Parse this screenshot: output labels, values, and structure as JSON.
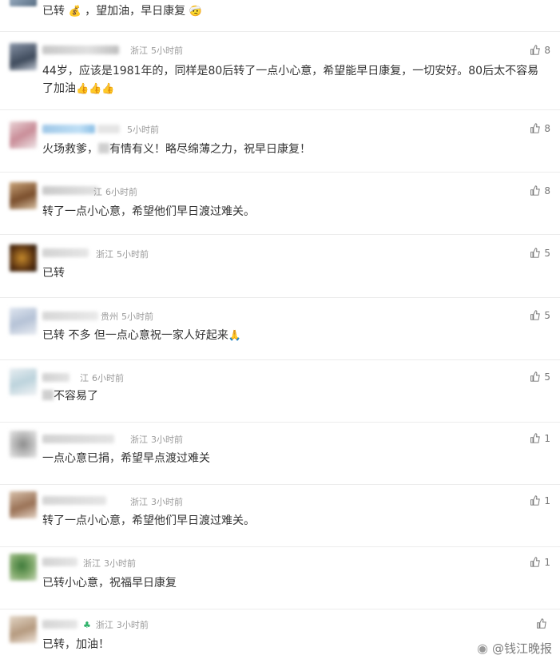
{
  "top_comment": {
    "parts": [
      "已转",
      "，望加油，早日康复"
    ],
    "icons": [
      "money-bag-emoji-icon",
      "hospital-face-emoji-icon"
    ]
  },
  "comments": [
    {
      "location": "浙江",
      "time": "5小时前",
      "content_parts": [
        "44岁，应该是1981年的，同样是80后转了一点小心意，希望能早日康复，一切安好。80后太不容易了加油",
        "👍👍👍"
      ],
      "likes": "8"
    },
    {
      "location": "",
      "time": "5小时前",
      "content_parts": [
        "火场救爹，",
        "有情有义！略尽绵薄之力，祝早日康复！"
      ],
      "likes": "8"
    },
    {
      "location": "江",
      "time": "6小时前",
      "content_parts": [
        "转了一点小心意，希望他们早日渡过难关。"
      ],
      "likes": "8"
    },
    {
      "location": "浙江",
      "time": "5小时前",
      "content_parts": [
        "已转"
      ],
      "likes": "5"
    },
    {
      "location": "贵州",
      "time": "5小时前",
      "content_parts": [
        "已转 不多 但一点心意祝一家人好起来",
        "🙏"
      ],
      "likes": "5"
    },
    {
      "location": "江",
      "time": "6小时前",
      "content_parts": [
        "",
        "不容易了"
      ],
      "likes": "5"
    },
    {
      "location": "浙江",
      "time": "3小时前",
      "content_parts": [
        "一点心意",
        "已捐，希望早点渡过难关"
      ],
      "likes": "1"
    },
    {
      "location": "浙江",
      "time": "3小时前",
      "content_parts": [
        "转了一点小心意，希望他们早日渡过难关。"
      ],
      "likes": "1"
    },
    {
      "location": "浙江",
      "time": "3小时前",
      "content_parts": [
        "已转",
        "小心意，祝福早日康复"
      ],
      "likes": "1"
    },
    {
      "location": "浙江",
      "time": "3小时前",
      "content_parts": [
        "已转，加油！"
      ],
      "likes": ""
    }
  ],
  "watermark": "@钱江晚报",
  "colors": {
    "meta": "#9a9a9a",
    "text": "#333333",
    "divider": "#ececec"
  }
}
